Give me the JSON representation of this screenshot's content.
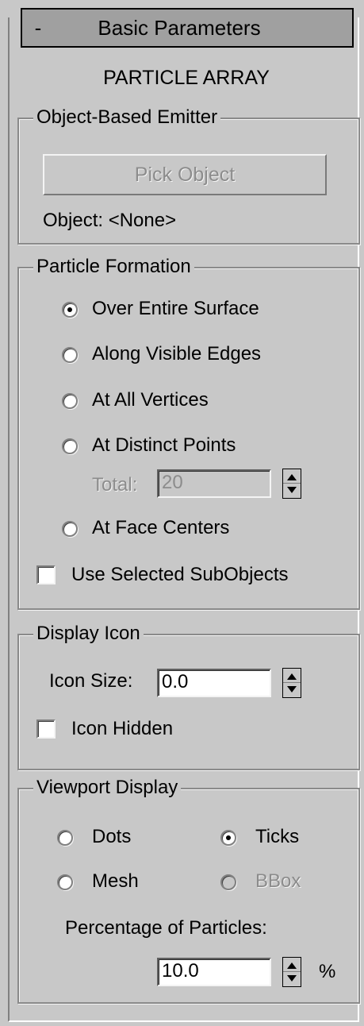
{
  "rollout": {
    "collapse_symbol": "-",
    "title": "Basic Parameters",
    "subtitle": "PARTICLE ARRAY"
  },
  "emitter": {
    "label": "Object-Based Emitter",
    "pick_button": "Pick Object",
    "object_text": "Object: <None>"
  },
  "formation": {
    "label": "Particle Formation",
    "options": [
      {
        "label": "Over Entire Surface",
        "selected": true
      },
      {
        "label": "Along Visible Edges",
        "selected": false
      },
      {
        "label": "At All Vertices",
        "selected": false
      },
      {
        "label": "At Distinct Points",
        "selected": false
      },
      {
        "label": "At Face Centers",
        "selected": false
      }
    ],
    "total_label": "Total:",
    "total_value": "20",
    "use_selected_label": "Use Selected SubObjects",
    "use_selected_checked": false
  },
  "display_icon": {
    "label": "Display Icon",
    "icon_size_label": "Icon Size:",
    "icon_size_value": "0.0",
    "icon_hidden_label": "Icon Hidden",
    "icon_hidden_checked": false
  },
  "viewport": {
    "label": "Viewport Display",
    "options": [
      {
        "label": "Dots",
        "selected": false,
        "enabled": true
      },
      {
        "label": "Ticks",
        "selected": true,
        "enabled": true
      },
      {
        "label": "Mesh",
        "selected": false,
        "enabled": true
      },
      {
        "label": "BBox",
        "selected": false,
        "enabled": false
      }
    ],
    "percentage_label": "Percentage of Particles:",
    "percentage_value": "10.0",
    "percent_unit": "%"
  },
  "colors": {
    "panel_bg": "#c8c8c8",
    "header_bg": "#a0a0a0",
    "disabled_text": "#8c8c8c"
  }
}
